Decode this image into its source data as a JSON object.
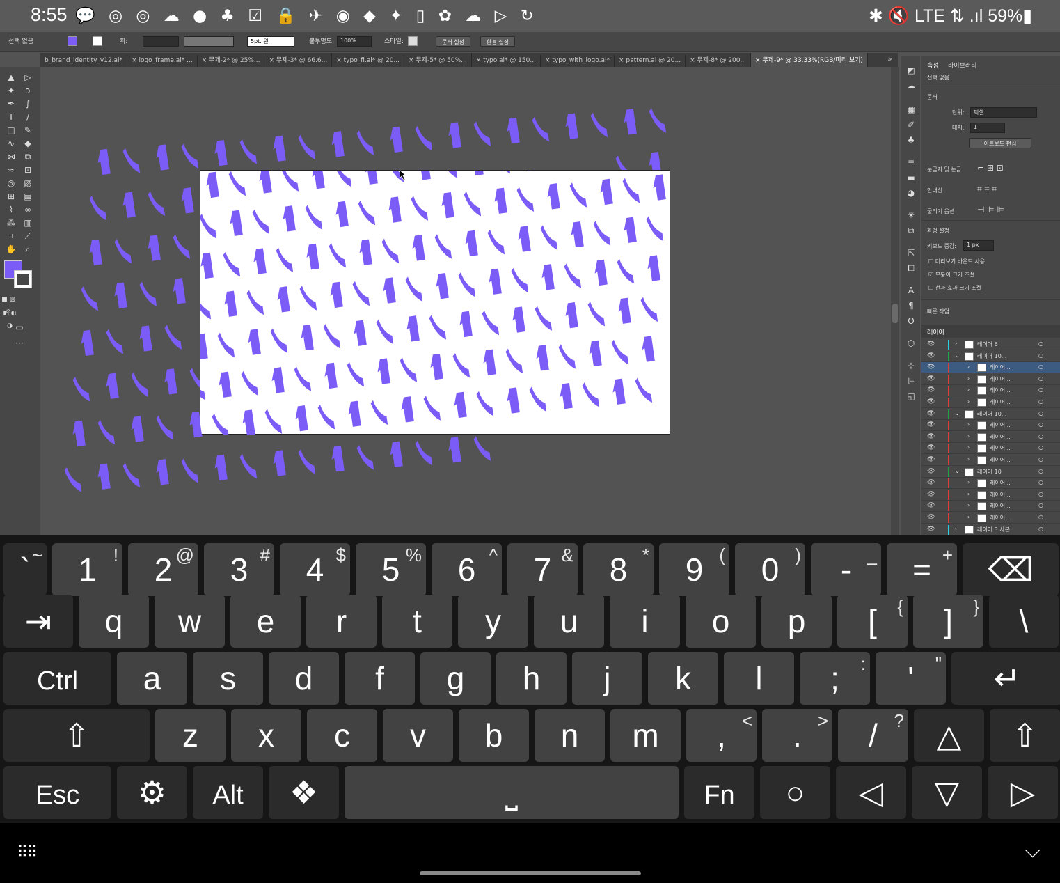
{
  "status_bar": {
    "time": "8:55",
    "left_icons": "💬 ◎ ◎ ☁ ● ♣ ☑ 🔒 ✈ ◉ ◆ ✦ ▯ ✿ ☁ ▷ ↻",
    "right_text": "✱ 🔇 LTE ⇅ .ıl 59%▮"
  },
  "control_bar": {
    "selection_label": "선택 없음",
    "stroke_label": "획:",
    "brush_value": "5pt. 원",
    "opacity_label": "불투명도:",
    "opacity_value": "100%",
    "style_label": "스타일:",
    "doc_setup_button": "문서 설정",
    "prefs_button": "환경 설정",
    "fill_color": "#7b5cf6"
  },
  "tabs": [
    "b_brand_identity_v12.ai*",
    "× logo_frame.ai* ...",
    "× 무제-2* @ 25%...",
    "× 무제-3* @ 66.6...",
    "× typo_fi.ai* @ 20...",
    "× 무제-5* @ 50%...",
    "× typo.ai* @ 150...",
    "× typo_with_logo.ai*",
    "× pattern.ai @ 20...",
    "× 무제-8* @ 200...",
    "× 무제-9* @ 33.33%(RGB/미리 보기)"
  ],
  "tabs_overflow": "»",
  "properties_panel": {
    "tab_properties": "속성",
    "tab_libraries": "라이브러리",
    "no_selection": "선택 없음",
    "document_section": "문서",
    "units_label": "단위:",
    "units_value": "픽셀",
    "artboard_label": "대지:",
    "artboard_value": "1",
    "edit_artboards_button": "아트보드 편집",
    "rulers_grids": "눈금자 및 눈금",
    "guides": "안내선",
    "snap_options": "물리기 옵션",
    "prefs_section": "환경 설정",
    "keyboard_increment_label": "키보드 증감:",
    "keyboard_increment_value": "1 px",
    "check_preview_bounds": "미리보기 바운드 사용",
    "check_scale_corners": "모퉁이 크기 조절",
    "check_scale_strokes": "선과 효과 크기 조절",
    "quick_actions": "빠른 작업"
  },
  "layers_panel": {
    "title": "레이어",
    "rows": [
      {
        "name": "레이어 6",
        "indent": 0,
        "expanded": false,
        "color": "#2ad0e0"
      },
      {
        "name": "레이어 10...",
        "indent": 0,
        "expanded": true,
        "color": "#22a34a"
      },
      {
        "name": "레이어...",
        "indent": 1,
        "expanded": false,
        "color": "#e03a3a"
      },
      {
        "name": "레이어...",
        "indent": 1,
        "expanded": false,
        "color": "#e03a3a"
      },
      {
        "name": "레이어...",
        "indent": 1,
        "expanded": false,
        "color": "#e03a3a"
      },
      {
        "name": "레이어...",
        "indent": 1,
        "expanded": false,
        "color": "#e03a3a"
      },
      {
        "name": "레이어 10...",
        "indent": 0,
        "expanded": true,
        "color": "#22a34a"
      },
      {
        "name": "레이어...",
        "indent": 1,
        "expanded": false,
        "color": "#e03a3a"
      },
      {
        "name": "레이어...",
        "indent": 1,
        "expanded": false,
        "color": "#e03a3a"
      },
      {
        "name": "레이어...",
        "indent": 1,
        "expanded": false,
        "color": "#e03a3a"
      },
      {
        "name": "레이어...",
        "indent": 1,
        "expanded": false,
        "color": "#e03a3a"
      },
      {
        "name": "레이어 10",
        "indent": 0,
        "expanded": true,
        "color": "#22a34a"
      },
      {
        "name": "레이어...",
        "indent": 1,
        "expanded": false,
        "color": "#e03a3a"
      },
      {
        "name": "레이어...",
        "indent": 1,
        "expanded": false,
        "color": "#e03a3a"
      },
      {
        "name": "레이어...",
        "indent": 1,
        "expanded": false,
        "color": "#e03a3a"
      },
      {
        "name": "레이어...",
        "indent": 1,
        "expanded": false,
        "color": "#e03a3a"
      },
      {
        "name": "레이어 3 사본",
        "indent": 0,
        "expanded": false,
        "color": "#2ad0e0"
      }
    ]
  },
  "keyboard": {
    "row1": [
      {
        "main": "`",
        "sup": "~"
      },
      {
        "main": "1",
        "sup": "!"
      },
      {
        "main": "2",
        "sup": "@"
      },
      {
        "main": "3",
        "sup": "#"
      },
      {
        "main": "4",
        "sup": "$"
      },
      {
        "main": "5",
        "sup": "%"
      },
      {
        "main": "6",
        "sup": "^"
      },
      {
        "main": "7",
        "sup": "&"
      },
      {
        "main": "8",
        "sup": "*"
      },
      {
        "main": "9",
        "sup": "("
      },
      {
        "main": "0",
        "sup": ")"
      },
      {
        "main": "-",
        "sup": "_"
      },
      {
        "main": "=",
        "sup": "+"
      },
      {
        "main": "⌫",
        "sup": ""
      }
    ],
    "row2": [
      {
        "main": "⇥",
        "sup": ""
      },
      {
        "main": "q",
        "sup": ""
      },
      {
        "main": "w",
        "sup": ""
      },
      {
        "main": "e",
        "sup": ""
      },
      {
        "main": "r",
        "sup": ""
      },
      {
        "main": "t",
        "sup": ""
      },
      {
        "main": "y",
        "sup": ""
      },
      {
        "main": "u",
        "sup": ""
      },
      {
        "main": "i",
        "sup": ""
      },
      {
        "main": "o",
        "sup": ""
      },
      {
        "main": "p",
        "sup": ""
      },
      {
        "main": "[",
        "sup": "{"
      },
      {
        "main": "]",
        "sup": "}"
      },
      {
        "main": "\\",
        "sup": ""
      }
    ],
    "row3": [
      {
        "main": "Ctrl",
        "sup": ""
      },
      {
        "main": "a",
        "sup": ""
      },
      {
        "main": "s",
        "sup": ""
      },
      {
        "main": "d",
        "sup": ""
      },
      {
        "main": "f",
        "sup": ""
      },
      {
        "main": "g",
        "sup": ""
      },
      {
        "main": "h",
        "sup": ""
      },
      {
        "main": "j",
        "sup": ""
      },
      {
        "main": "k",
        "sup": ""
      },
      {
        "main": "l",
        "sup": ""
      },
      {
        "main": ";",
        "sup": ":"
      },
      {
        "main": "'",
        "sup": "\""
      },
      {
        "main": "↵",
        "sup": ""
      }
    ],
    "row4": [
      {
        "main": "⇧",
        "sup": ""
      },
      {
        "main": "z",
        "sup": ""
      },
      {
        "main": "x",
        "sup": ""
      },
      {
        "main": "c",
        "sup": ""
      },
      {
        "main": "v",
        "sup": ""
      },
      {
        "main": "b",
        "sup": ""
      },
      {
        "main": "n",
        "sup": ""
      },
      {
        "main": "m",
        "sup": ""
      },
      {
        "main": ",",
        "sup": "<"
      },
      {
        "main": ".",
        "sup": ">"
      },
      {
        "main": "/",
        "sup": "?"
      },
      {
        "main": "△",
        "sup": ""
      },
      {
        "main": "⇧",
        "sup": ""
      }
    ],
    "row5": [
      {
        "main": "Esc",
        "sup": ""
      },
      {
        "main": "⚙",
        "sup": ""
      },
      {
        "main": "Alt",
        "sup": ""
      },
      {
        "main": "❖",
        "sup": ""
      },
      {
        "main": "⎵",
        "sup": ""
      },
      {
        "main": "Fn",
        "sup": ""
      },
      {
        "main": "○",
        "sup": ""
      },
      {
        "main": "◁",
        "sup": ""
      },
      {
        "main": "▽",
        "sup": ""
      },
      {
        "main": "▷",
        "sup": ""
      }
    ]
  },
  "nav_bar": {
    "keyboard_icon": "⠿⠿",
    "collapse_icon": "⌵"
  }
}
